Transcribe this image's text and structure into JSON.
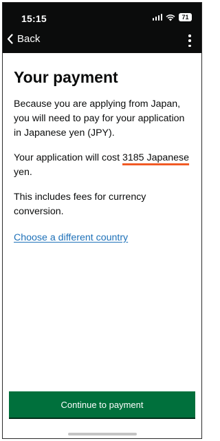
{
  "status_bar": {
    "time": "15:15",
    "battery": "71",
    "icons": [
      "signal-icon",
      "wifi-icon",
      "battery-icon"
    ]
  },
  "header": {
    "back_label": "Back",
    "back_icon": "chevron-left-icon",
    "menu_icon": "more-vertical-icon"
  },
  "main": {
    "title": "Your payment",
    "intro": "Because you are applying from Japan, you will need to pay for your application in Japanese yen (JPY).",
    "cost_prefix": "Your application will cost ",
    "cost_amount": "3185 Japanese",
    "cost_suffix": " yen.",
    "fees_note": "This includes fees for currency conversion.",
    "change_country_link": "Choose a different country"
  },
  "footer": {
    "continue_label": "Continue to payment"
  },
  "colors": {
    "header_bg": "#0b0c0c",
    "button_green": "#00703c",
    "link_blue": "#1d70b8",
    "highlight_underline": "#f15a24"
  }
}
